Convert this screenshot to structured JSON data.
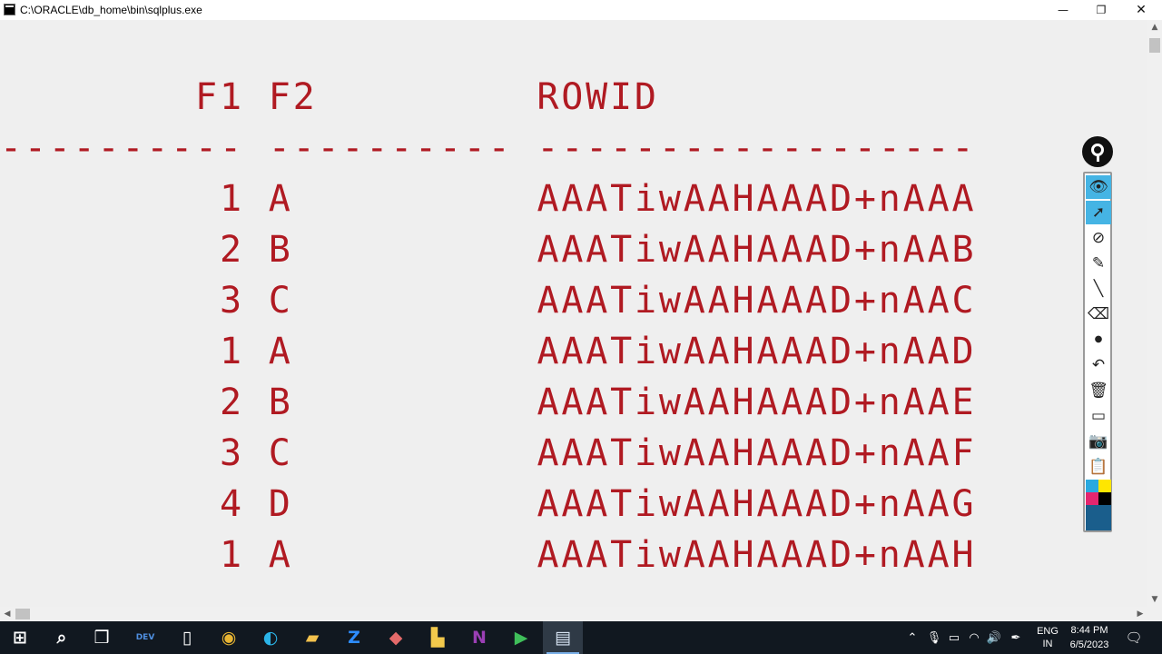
{
  "window": {
    "title": "C:\\ORACLE\\db_home\\bin\\sqlplus.exe",
    "minimize_glyph": "—",
    "maximize_glyph": "❐",
    "close_glyph": "✕"
  },
  "console": {
    "text_color": "#b01a22",
    "background": "#efefef",
    "header_line": "        F1 F2         ROWID",
    "separator_line": "---------- ---------- ------------------",
    "rows": [
      {
        "f1": "1",
        "f2": "A",
        "rowid": "AAATiwAAHAAAD+nAAA"
      },
      {
        "f1": "2",
        "f2": "B",
        "rowid": "AAATiwAAHAAAD+nAAB"
      },
      {
        "f1": "3",
        "f2": "C",
        "rowid": "AAATiwAAHAAAD+nAAC"
      },
      {
        "f1": "1",
        "f2": "A",
        "rowid": "AAATiwAAHAAAD+nAAD"
      },
      {
        "f1": "2",
        "f2": "B",
        "rowid": "AAATiwAAHAAAD+nAAE"
      },
      {
        "f1": "3",
        "f2": "C",
        "rowid": "AAATiwAAHAAAD+nAAF"
      },
      {
        "f1": "4",
        "f2": "D",
        "rowid": "AAATiwAAHAAAD+nAAG"
      },
      {
        "f1": "1",
        "f2": "A",
        "rowid": "AAATiwAAHAAAD+nAAH"
      }
    ]
  },
  "annotation_toolbar": {
    "tools": [
      {
        "name": "eye-icon",
        "glyph": "👁",
        "active": true
      },
      {
        "name": "cursor-icon",
        "glyph": "➚",
        "active": true
      },
      {
        "name": "disable-pen-icon",
        "glyph": "⊘",
        "active": false
      },
      {
        "name": "highlighter-icon",
        "glyph": "✎",
        "active": false
      },
      {
        "name": "line-icon",
        "glyph": "╲",
        "active": false
      },
      {
        "name": "eraser-icon",
        "glyph": "⌫",
        "active": false
      },
      {
        "name": "dot-icon",
        "glyph": "●",
        "active": false
      },
      {
        "name": "undo-icon",
        "glyph": "↶",
        "active": false
      },
      {
        "name": "trash-icon",
        "glyph": "🗑",
        "active": false
      },
      {
        "name": "whiteboard-icon",
        "glyph": "▭",
        "active": false
      },
      {
        "name": "camera-icon",
        "glyph": "📷",
        "active": false
      },
      {
        "name": "clipboard-icon",
        "glyph": "📋",
        "active": false
      }
    ],
    "swatches": [
      "#29a9e0",
      "#ffe600",
      "#e4266f",
      "#000000"
    ],
    "big_swatch": "#1a5e8c",
    "accent_active": "#45b4e4",
    "dot_color": "#e4266f"
  },
  "taskbar": {
    "apps": [
      {
        "name": "start-button",
        "glyph": "⊞",
        "color": "#ffffff"
      },
      {
        "name": "search-icon",
        "glyph": "⌕",
        "color": "#ffffff"
      },
      {
        "name": "task-view-icon",
        "glyph": "❒",
        "color": "#ffffff"
      },
      {
        "name": "dev-app-icon",
        "glyph": "DEV",
        "color": "#4f8fe0"
      },
      {
        "name": "file-icon",
        "glyph": "▯",
        "color": "#ffffff"
      },
      {
        "name": "chrome-icon",
        "glyph": "◉",
        "color": "#e8b533"
      },
      {
        "name": "edge-icon",
        "glyph": "◐",
        "color": "#2bb4e8"
      },
      {
        "name": "file-explorer-icon",
        "glyph": "▰",
        "color": "#f4c24d"
      },
      {
        "name": "zoom-icon",
        "glyph": "Z",
        "color": "#2d8cff"
      },
      {
        "name": "eraser-app-icon",
        "glyph": "◆",
        "color": "#e46a6a"
      },
      {
        "name": "sticky-notes-icon",
        "glyph": "▙",
        "color": "#f2c94c"
      },
      {
        "name": "onenote-icon",
        "glyph": "N",
        "color": "#9b3fb5"
      },
      {
        "name": "media-app-icon",
        "glyph": "▶",
        "color": "#3fbf5a"
      },
      {
        "name": "sqlplus-taskbar-icon",
        "glyph": "▤",
        "color": "#d8e6f5"
      }
    ],
    "tray_icons": [
      {
        "name": "chevron-up-icon",
        "glyph": "⌃"
      },
      {
        "name": "microphone-icon",
        "glyph": "🎙"
      },
      {
        "name": "battery-icon",
        "glyph": "▭"
      },
      {
        "name": "wifi-icon",
        "glyph": "◠"
      },
      {
        "name": "volume-icon",
        "glyph": "🔊"
      },
      {
        "name": "pen-icon",
        "glyph": "✒"
      }
    ],
    "lang_primary": "ENG",
    "lang_secondary": "IN",
    "time": "8:44 PM",
    "date": "6/5/2023",
    "notification_glyph": "🗨"
  }
}
